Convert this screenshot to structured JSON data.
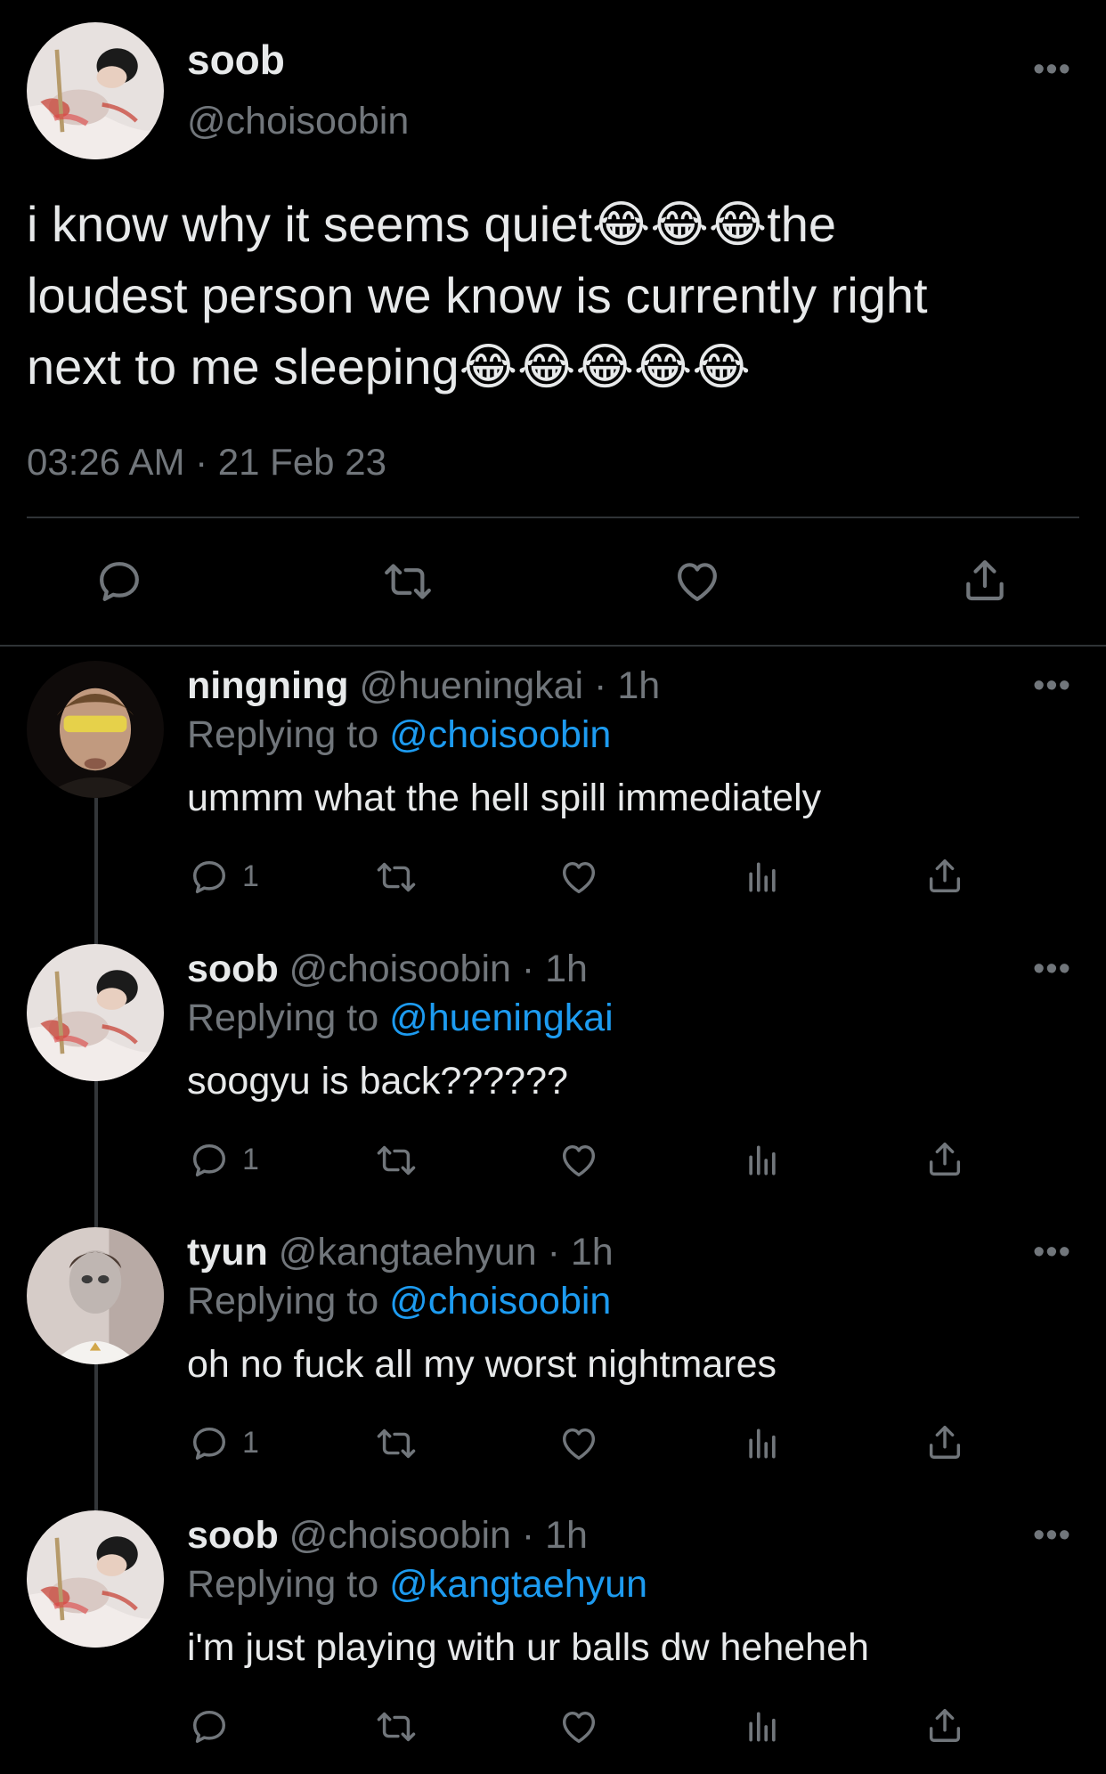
{
  "main_tweet": {
    "name": "soob",
    "handle": "@choisoobin",
    "text_lines": [
      "i know why it seems quiet😂😂😂the",
      "loudest person we know is currently right",
      "next to me sleeping😂😂😂😂😂"
    ],
    "timestamp": "03:26 AM · 21 Feb 23",
    "actions": [
      "reply-icon",
      "retweet-icon",
      "like-icon",
      "share-icon"
    ]
  },
  "replies": [
    {
      "name": "ningning",
      "handle": "@hueningkai · 1h",
      "replying_prefix": "Replying to ",
      "replying_to": "@choisoobin",
      "text": "ummm what the hell spill immediately",
      "reply_count": "1"
    },
    {
      "name": "soob",
      "handle": "@choisoobin · 1h",
      "replying_prefix": "Replying to ",
      "replying_to": "@hueningkai",
      "text": "soogyu is back??????",
      "reply_count": "1"
    },
    {
      "name": "tyun",
      "handle": "@kangtaehyun · 1h",
      "replying_prefix": "Replying to ",
      "replying_to": "@choisoobin",
      "text": "oh no fuck all my worst nightmares",
      "reply_count": "1"
    },
    {
      "name": "soob",
      "handle": "@choisoobin · 1h",
      "replying_prefix": "Replying to ",
      "replying_to": "@kangtaehyun",
      "text": "i'm just playing with ur balls dw heheheh",
      "reply_count": ""
    }
  ],
  "more_glyph": "•••",
  "colors": {
    "background": "#000000",
    "text": "#e7e9ea",
    "muted": "#71767b",
    "link": "#1d9bf0",
    "divider": "#2f3336"
  }
}
